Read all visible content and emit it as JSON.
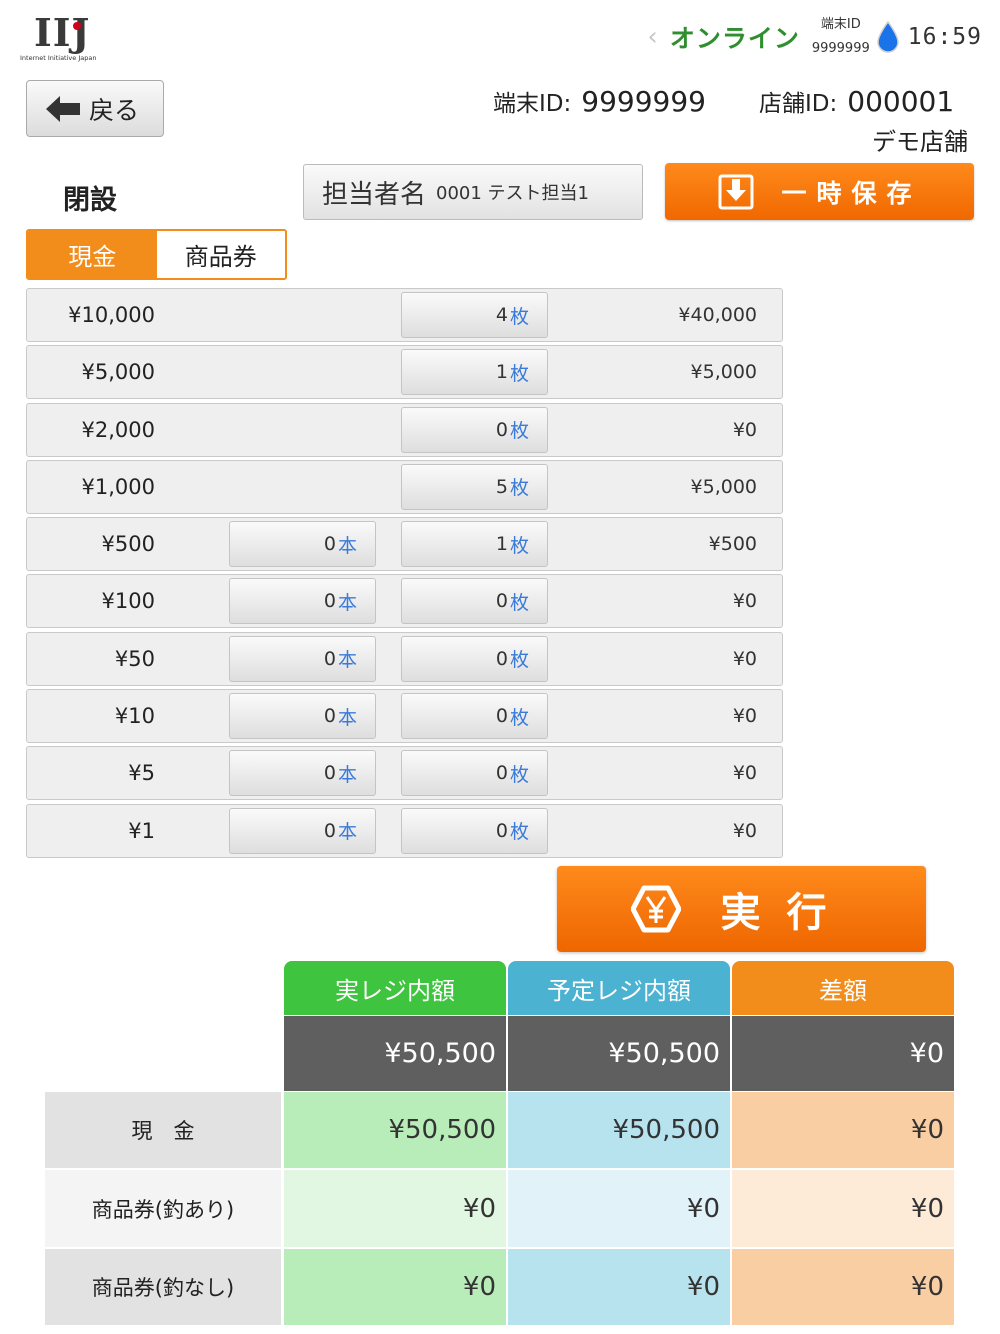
{
  "logo": {
    "main": "IIJ",
    "sub": "Internet Initiative Japan"
  },
  "status": {
    "online": "オンライン",
    "terminal_label": "端末ID",
    "terminal_value": "9999999",
    "time": "16:59"
  },
  "back": {
    "label": "戻る"
  },
  "info": {
    "terminal_label": "端末ID:",
    "terminal_value": "9999999",
    "store_label": "店舗ID:",
    "store_value": "000001",
    "store_name": "デモ店舗"
  },
  "title": "閉設",
  "staff": {
    "label": "担当者名",
    "value": "0001 テスト担当1"
  },
  "save": {
    "label": "一時保存"
  },
  "tabs": [
    {
      "label": "現金"
    },
    {
      "label": "商品券"
    }
  ],
  "units": {
    "roll": "本",
    "sheet": "枚"
  },
  "denominations": [
    {
      "label": "¥10,000",
      "sheets": "4",
      "amount": "¥40,000"
    },
    {
      "label": "¥5,000",
      "sheets": "1",
      "amount": "¥5,000"
    },
    {
      "label": "¥2,000",
      "sheets": "0",
      "amount": "¥0"
    },
    {
      "label": "¥1,000",
      "sheets": "5",
      "amount": "¥5,000"
    },
    {
      "label": "¥500",
      "rolls": "0",
      "sheets": "1",
      "amount": "¥500"
    },
    {
      "label": "¥100",
      "rolls": "0",
      "sheets": "0",
      "amount": "¥0"
    },
    {
      "label": "¥50",
      "rolls": "0",
      "sheets": "0",
      "amount": "¥0"
    },
    {
      "label": "¥10",
      "rolls": "0",
      "sheets": "0",
      "amount": "¥0"
    },
    {
      "label": "¥5",
      "rolls": "0",
      "sheets": "0",
      "amount": "¥0"
    },
    {
      "label": "¥1",
      "rolls": "0",
      "sheets": "0",
      "amount": "¥0"
    }
  ],
  "execute": {
    "label": "実行"
  },
  "summary": {
    "headers": [
      "実レジ内額",
      "予定レジ内額",
      "差額"
    ],
    "totals": [
      "¥50,500",
      "¥50,500",
      "¥0"
    ],
    "rows": [
      {
        "label": "現　金",
        "values": [
          "¥50,500",
          "¥50,500",
          "¥0"
        ]
      },
      {
        "label": "商品券(釣あり)",
        "values": [
          "¥0",
          "¥0",
          "¥0"
        ]
      },
      {
        "label": "商品券(釣なし)",
        "values": [
          "¥0",
          "¥0",
          "¥0"
        ]
      }
    ]
  },
  "colors": {
    "accent": "#f28c1a",
    "online": "#2f8f2f",
    "actual_head": "#3ec43e",
    "actual_light": "#b8ecb8",
    "actual_lighter": "#e2f7e2",
    "planned_head": "#4bb3d1",
    "planned_light": "#b7e3ef",
    "planned_lighter": "#e1f3f9",
    "diff_head": "#f28c1a",
    "diff_light": "#f9cea2",
    "diff_lighter": "#fdebd7"
  }
}
